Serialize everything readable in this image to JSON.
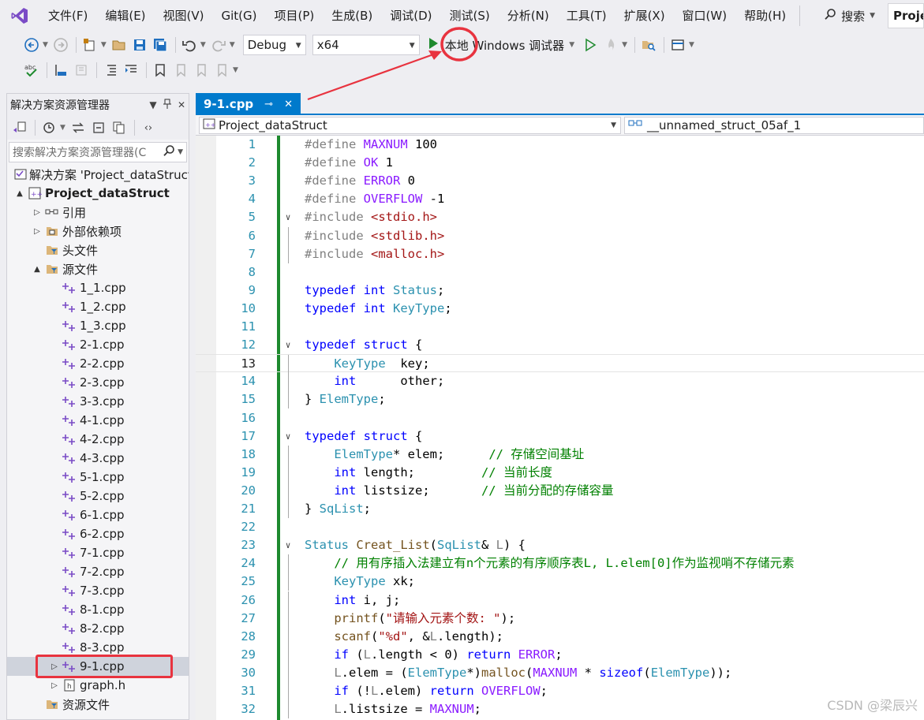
{
  "menu": {
    "items": [
      "文件(F)",
      "编辑(E)",
      "视图(V)",
      "Git(G)",
      "项目(P)",
      "生成(B)",
      "调试(D)",
      "测试(S)",
      "分析(N)",
      "工具(T)",
      "扩展(X)",
      "窗口(W)",
      "帮助(H)"
    ],
    "search_label": "搜索",
    "project_badge": "Proje"
  },
  "toolbar": {
    "config": "Debug",
    "platform": "x64",
    "run_label": "本地 Windows 调试器"
  },
  "solution_explorer": {
    "title": "解决方案资源管理器",
    "search_placeholder": "搜索解决方案资源管理器(C",
    "tree": [
      {
        "label": "解决方案 'Project_dataStruct'",
        "level": 0,
        "expander": "",
        "icon": "solution-icon"
      },
      {
        "label": "Project_dataStruct",
        "level": 0,
        "expander": "▲",
        "icon": "project-icon",
        "bold": true
      },
      {
        "label": "引用",
        "level": 1,
        "expander": "▷",
        "icon": "references-icon"
      },
      {
        "label": "外部依赖项",
        "level": 1,
        "expander": "▷",
        "icon": "external-deps-icon"
      },
      {
        "label": "头文件",
        "level": 1,
        "expander": "",
        "icon": "filter-folder-icon"
      },
      {
        "label": "源文件",
        "level": 1,
        "expander": "▲",
        "icon": "filter-folder-icon"
      },
      {
        "label": "1_1.cpp",
        "level": 2,
        "expander": "",
        "icon": "cpp-file-icon"
      },
      {
        "label": "1_2.cpp",
        "level": 2,
        "expander": "",
        "icon": "cpp-file-icon"
      },
      {
        "label": "1_3.cpp",
        "level": 2,
        "expander": "",
        "icon": "cpp-file-icon"
      },
      {
        "label": "2-1.cpp",
        "level": 2,
        "expander": "",
        "icon": "cpp-file-icon"
      },
      {
        "label": "2-2.cpp",
        "level": 2,
        "expander": "",
        "icon": "cpp-file-icon"
      },
      {
        "label": "2-3.cpp",
        "level": 2,
        "expander": "",
        "icon": "cpp-file-icon"
      },
      {
        "label": "3-3.cpp",
        "level": 2,
        "expander": "",
        "icon": "cpp-file-icon"
      },
      {
        "label": "4-1.cpp",
        "level": 2,
        "expander": "",
        "icon": "cpp-file-icon"
      },
      {
        "label": "4-2.cpp",
        "level": 2,
        "expander": "",
        "icon": "cpp-file-icon"
      },
      {
        "label": "4-3.cpp",
        "level": 2,
        "expander": "",
        "icon": "cpp-file-icon"
      },
      {
        "label": "5-1.cpp",
        "level": 2,
        "expander": "",
        "icon": "cpp-file-icon"
      },
      {
        "label": "5-2.cpp",
        "level": 2,
        "expander": "",
        "icon": "cpp-file-icon"
      },
      {
        "label": "6-1.cpp",
        "level": 2,
        "expander": "",
        "icon": "cpp-file-icon"
      },
      {
        "label": "6-2.cpp",
        "level": 2,
        "expander": "",
        "icon": "cpp-file-icon"
      },
      {
        "label": "7-1.cpp",
        "level": 2,
        "expander": "",
        "icon": "cpp-file-icon"
      },
      {
        "label": "7-2.cpp",
        "level": 2,
        "expander": "",
        "icon": "cpp-file-icon"
      },
      {
        "label": "7-3.cpp",
        "level": 2,
        "expander": "",
        "icon": "cpp-file-icon"
      },
      {
        "label": "8-1.cpp",
        "level": 2,
        "expander": "",
        "icon": "cpp-file-icon"
      },
      {
        "label": "8-2.cpp",
        "level": 2,
        "expander": "",
        "icon": "cpp-file-icon"
      },
      {
        "label": "8-3.cpp",
        "level": 2,
        "expander": "",
        "icon": "cpp-file-icon"
      },
      {
        "label": "9-1.cpp",
        "level": 2,
        "expander": "▷",
        "icon": "cpp-file-icon",
        "selected": true
      },
      {
        "label": "graph.h",
        "level": 2,
        "expander": "▷",
        "icon": "header-file-icon"
      },
      {
        "label": "资源文件",
        "level": 1,
        "expander": "",
        "icon": "filter-folder-icon"
      }
    ]
  },
  "editor": {
    "tab_label": "9-1.cpp",
    "nav_left": "Project_dataStruct",
    "nav_right": "__unnamed_struct_05af_1",
    "current_line": 13,
    "lines": [
      {
        "n": 1,
        "fold": "",
        "guide": false,
        "tokens": [
          [
            "pp",
            "#define "
          ],
          [
            "mac",
            "MAXNUM"
          ],
          [
            "num",
            " 100"
          ]
        ]
      },
      {
        "n": 2,
        "fold": "",
        "guide": false,
        "tokens": [
          [
            "pp",
            "#define "
          ],
          [
            "mac",
            "OK"
          ],
          [
            "num",
            " 1"
          ]
        ]
      },
      {
        "n": 3,
        "fold": "",
        "guide": false,
        "tokens": [
          [
            "pp",
            "#define "
          ],
          [
            "mac",
            "ERROR"
          ],
          [
            "num",
            " 0"
          ]
        ]
      },
      {
        "n": 4,
        "fold": "",
        "guide": false,
        "tokens": [
          [
            "pp",
            "#define "
          ],
          [
            "mac",
            "OVERFLOW"
          ],
          [
            "num",
            " -1"
          ]
        ]
      },
      {
        "n": 5,
        "fold": "∨",
        "guide": false,
        "tokens": [
          [
            "pp",
            "#include "
          ],
          [
            "str",
            "<stdio.h>"
          ]
        ]
      },
      {
        "n": 6,
        "fold": "",
        "guide": true,
        "tokens": [
          [
            "pp",
            "#include "
          ],
          [
            "str",
            "<stdlib.h>"
          ]
        ]
      },
      {
        "n": 7,
        "fold": "",
        "guide": true,
        "tokens": [
          [
            "pp",
            "#include "
          ],
          [
            "str",
            "<malloc.h>"
          ]
        ]
      },
      {
        "n": 8,
        "fold": "",
        "guide": false,
        "tokens": []
      },
      {
        "n": 9,
        "fold": "",
        "guide": false,
        "tokens": [
          [
            "kw",
            "typedef int "
          ],
          [
            "typ",
            "Status"
          ],
          [
            "num",
            ";"
          ]
        ]
      },
      {
        "n": 10,
        "fold": "",
        "guide": false,
        "tokens": [
          [
            "kw",
            "typedef int "
          ],
          [
            "typ",
            "KeyType"
          ],
          [
            "num",
            ";"
          ]
        ]
      },
      {
        "n": 11,
        "fold": "",
        "guide": false,
        "tokens": []
      },
      {
        "n": 12,
        "fold": "∨",
        "guide": false,
        "tokens": [
          [
            "kw",
            "typedef struct "
          ],
          [
            "num",
            "{"
          ]
        ]
      },
      {
        "n": 13,
        "fold": "",
        "guide": true,
        "tokens": [
          [
            "num",
            "    "
          ],
          [
            "typ",
            "KeyType"
          ],
          [
            "num",
            "  key;"
          ]
        ]
      },
      {
        "n": 14,
        "fold": "",
        "guide": true,
        "tokens": [
          [
            "num",
            "    "
          ],
          [
            "kw",
            "int"
          ],
          [
            "num",
            "      other;"
          ]
        ]
      },
      {
        "n": 15,
        "fold": "",
        "guide": true,
        "tokens": [
          [
            "num",
            "} "
          ],
          [
            "typ",
            "ElemType"
          ],
          [
            "num",
            ";"
          ]
        ]
      },
      {
        "n": 16,
        "fold": "",
        "guide": false,
        "tokens": []
      },
      {
        "n": 17,
        "fold": "∨",
        "guide": false,
        "tokens": [
          [
            "kw",
            "typedef struct "
          ],
          [
            "num",
            "{"
          ]
        ]
      },
      {
        "n": 18,
        "fold": "",
        "guide": true,
        "tokens": [
          [
            "num",
            "    "
          ],
          [
            "typ",
            "ElemType"
          ],
          [
            "num",
            "* elem;      "
          ],
          [
            "cmt",
            "// 存储空间基址"
          ]
        ]
      },
      {
        "n": 19,
        "fold": "",
        "guide": true,
        "tokens": [
          [
            "num",
            "    "
          ],
          [
            "kw",
            "int"
          ],
          [
            "num",
            " length;         "
          ],
          [
            "cmt",
            "// 当前长度"
          ]
        ]
      },
      {
        "n": 20,
        "fold": "",
        "guide": true,
        "tokens": [
          [
            "num",
            "    "
          ],
          [
            "kw",
            "int"
          ],
          [
            "num",
            " listsize;       "
          ],
          [
            "cmt",
            "// 当前分配的存储容量"
          ]
        ]
      },
      {
        "n": 21,
        "fold": "",
        "guide": true,
        "tokens": [
          [
            "num",
            "} "
          ],
          [
            "typ",
            "SqList"
          ],
          [
            "num",
            ";"
          ]
        ]
      },
      {
        "n": 22,
        "fold": "",
        "guide": false,
        "tokens": []
      },
      {
        "n": 23,
        "fold": "∨",
        "guide": false,
        "tokens": [
          [
            "typ",
            "Status "
          ],
          [
            "fn",
            "Creat_List"
          ],
          [
            "num",
            "("
          ],
          [
            "typ",
            "SqList"
          ],
          [
            "num",
            "& "
          ],
          [
            "var",
            "L"
          ],
          [
            "num",
            ") {"
          ]
        ]
      },
      {
        "n": 24,
        "fold": "",
        "guide": true,
        "tokens": [
          [
            "num",
            "    "
          ],
          [
            "cmt",
            "// 用有序插入法建立有n个元素的有序顺序表L, L.elem[0]作为监视哨不存储元素"
          ]
        ]
      },
      {
        "n": 25,
        "fold": "",
        "guide": true,
        "tokens": [
          [
            "num",
            "    "
          ],
          [
            "typ",
            "KeyType"
          ],
          [
            "num",
            " xk;"
          ]
        ]
      },
      {
        "n": 26,
        "fold": "",
        "guide": true,
        "tokens": [
          [
            "num",
            "    "
          ],
          [
            "kw",
            "int"
          ],
          [
            "num",
            " i, j;"
          ]
        ]
      },
      {
        "n": 27,
        "fold": "",
        "guide": true,
        "tokens": [
          [
            "num",
            "    "
          ],
          [
            "fn",
            "printf"
          ],
          [
            "num",
            "("
          ],
          [
            "str",
            "\"请输入元素个数: \""
          ],
          [
            "num",
            ");"
          ]
        ]
      },
      {
        "n": 28,
        "fold": "",
        "guide": true,
        "tokens": [
          [
            "num",
            "    "
          ],
          [
            "fn",
            "scanf"
          ],
          [
            "num",
            "("
          ],
          [
            "str",
            "\"%d\""
          ],
          [
            "num",
            ", &"
          ],
          [
            "var",
            "L"
          ],
          [
            "num",
            ".length);"
          ]
        ]
      },
      {
        "n": 29,
        "fold": "",
        "guide": true,
        "tokens": [
          [
            "num",
            "    "
          ],
          [
            "kw",
            "if"
          ],
          [
            "num",
            " ("
          ],
          [
            "var",
            "L"
          ],
          [
            "num",
            ".length < 0) "
          ],
          [
            "kw",
            "return "
          ],
          [
            "mac",
            "ERROR"
          ],
          [
            "num",
            ";"
          ]
        ]
      },
      {
        "n": 30,
        "fold": "",
        "guide": true,
        "tokens": [
          [
            "num",
            "    "
          ],
          [
            "var",
            "L"
          ],
          [
            "num",
            ".elem = ("
          ],
          [
            "typ",
            "ElemType"
          ],
          [
            "num",
            "*)"
          ],
          [
            "fn",
            "malloc"
          ],
          [
            "num",
            "("
          ],
          [
            "mac",
            "MAXNUM"
          ],
          [
            "num",
            " * "
          ],
          [
            "kw",
            "sizeof"
          ],
          [
            "num",
            "("
          ],
          [
            "typ",
            "ElemType"
          ],
          [
            "num",
            "));"
          ]
        ]
      },
      {
        "n": 31,
        "fold": "",
        "guide": true,
        "tokens": [
          [
            "num",
            "    "
          ],
          [
            "kw",
            "if"
          ],
          [
            "num",
            " (!"
          ],
          [
            "var",
            "L"
          ],
          [
            "num",
            ".elem) "
          ],
          [
            "kw",
            "return "
          ],
          [
            "mac",
            "OVERFLOW"
          ],
          [
            "num",
            ";"
          ]
        ]
      },
      {
        "n": 32,
        "fold": "",
        "guide": true,
        "tokens": [
          [
            "num",
            "    "
          ],
          [
            "var",
            "L"
          ],
          [
            "num",
            ".listsize = "
          ],
          [
            "mac",
            "MAXNUM"
          ],
          [
            "num",
            ";"
          ]
        ]
      }
    ]
  },
  "watermark": "CSDN @梁辰兴",
  "colors": {
    "accent": "#007acc",
    "run_green": "#1e8a2e",
    "annotation_red": "#e8333f"
  }
}
